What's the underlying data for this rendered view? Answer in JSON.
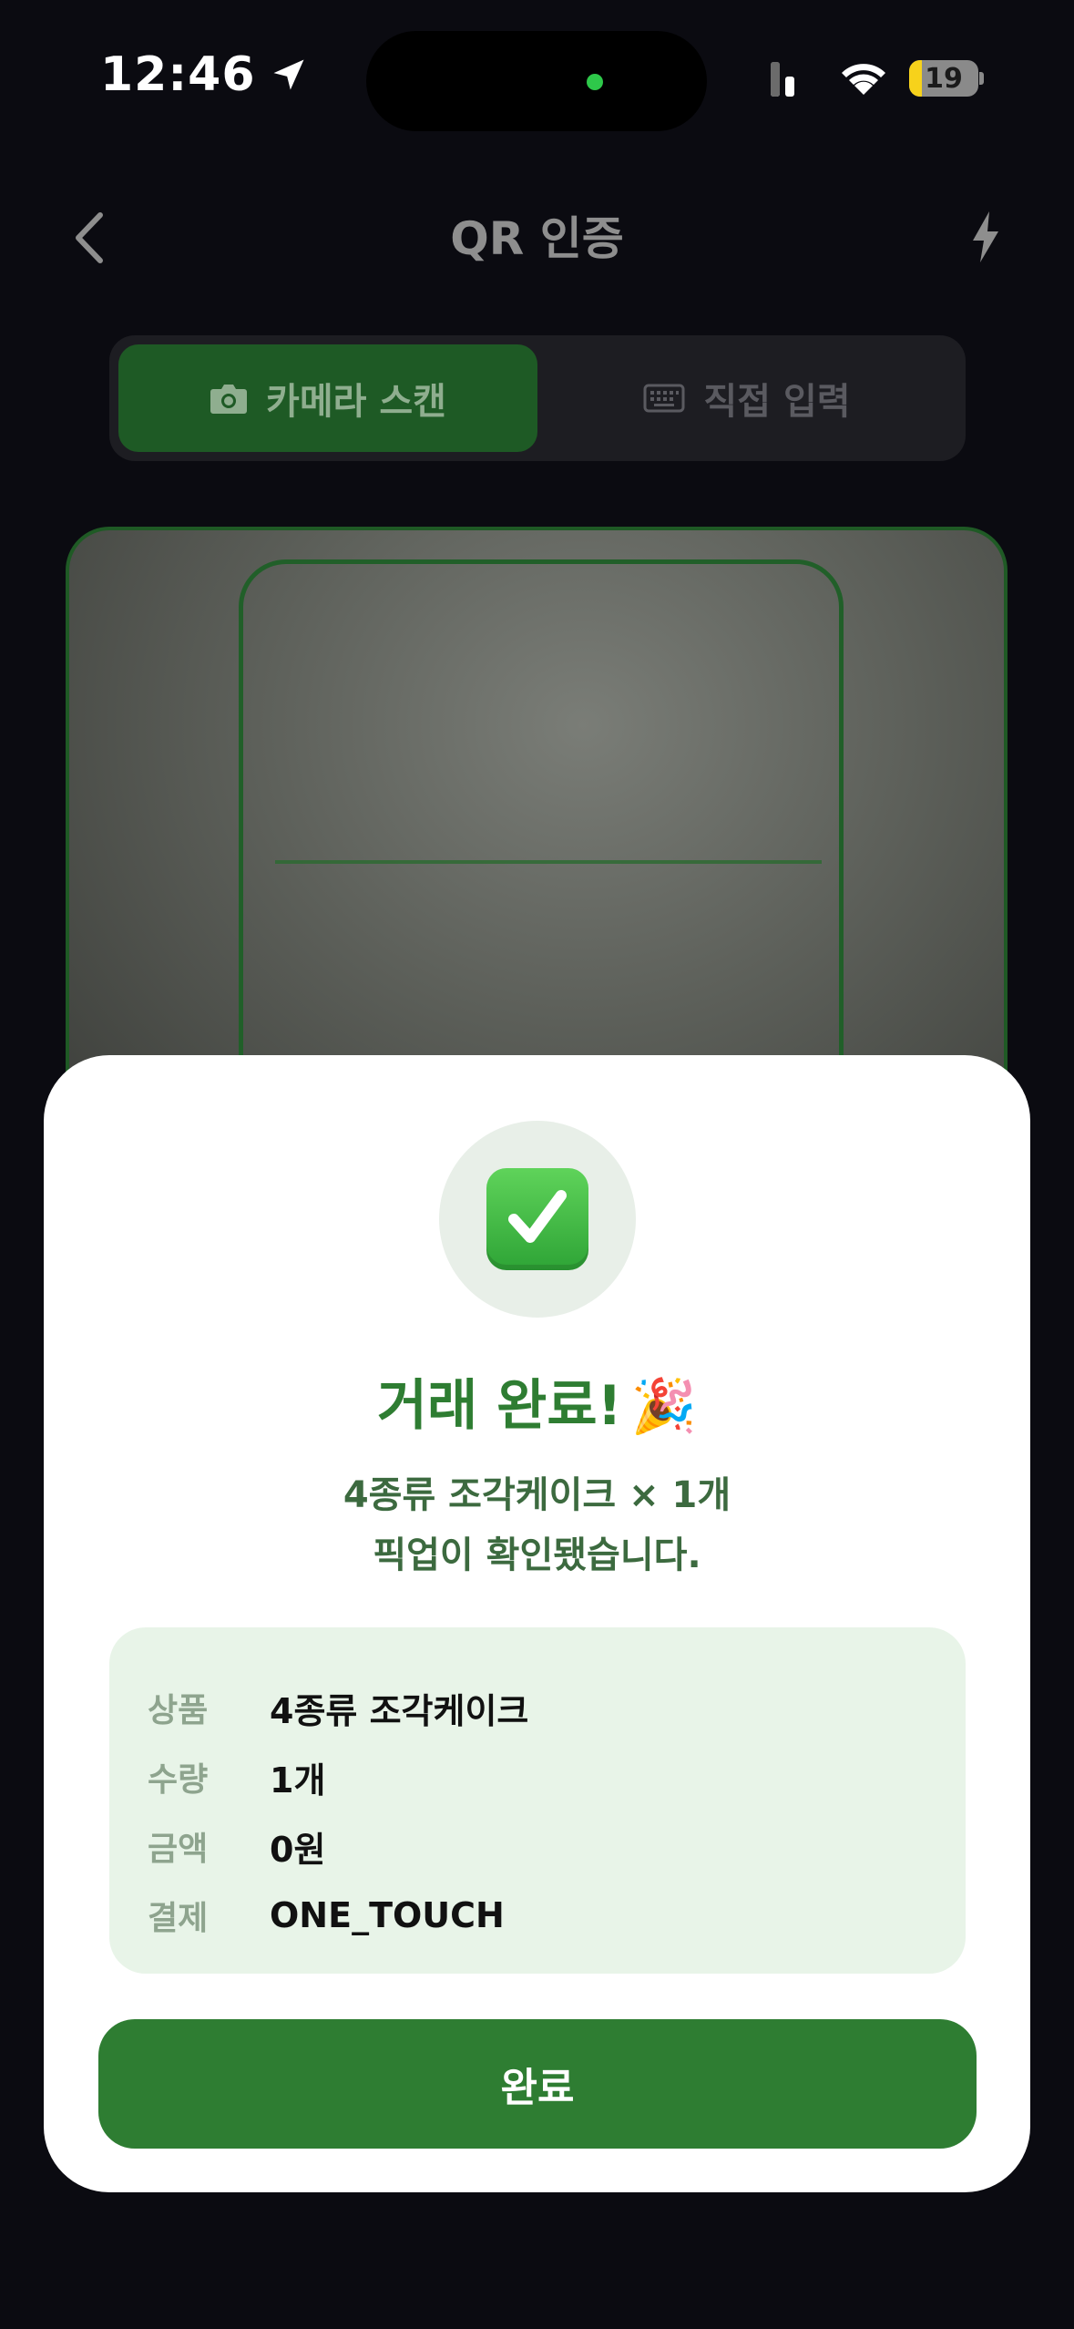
{
  "status": {
    "time": "12:46",
    "battery_level": "19"
  },
  "header": {
    "title": "QR 인증"
  },
  "tabs": [
    {
      "label": "카메라 스캔",
      "active": true
    },
    {
      "label": "직접 입력",
      "active": false
    }
  ],
  "sheet": {
    "title": "거래 완료!",
    "title_emoji": "🎉",
    "message_line1": "4종류 조각케이크 × 1개",
    "message_line2": "픽업이 확인됐습니다.",
    "details": [
      {
        "label": "상품",
        "value": "4종류 조각케이크"
      },
      {
        "label": "수량",
        "value": "1개"
      },
      {
        "label": "금액",
        "value": "0원"
      },
      {
        "label": "결제",
        "value": "ONE_TOUCH"
      }
    ],
    "done_label": "완료"
  },
  "colors": {
    "accent": "#2e7d32",
    "background": "#0b0b11",
    "details_bg": "#e8f4e8"
  },
  "icons": {
    "location": "location-arrow-icon",
    "wifi": "wifi-icon",
    "back": "chevron-left-icon",
    "flash": "flash-icon",
    "camera": "camera-icon",
    "keyboard": "keyboard-icon",
    "check": "check-mark-icon"
  }
}
